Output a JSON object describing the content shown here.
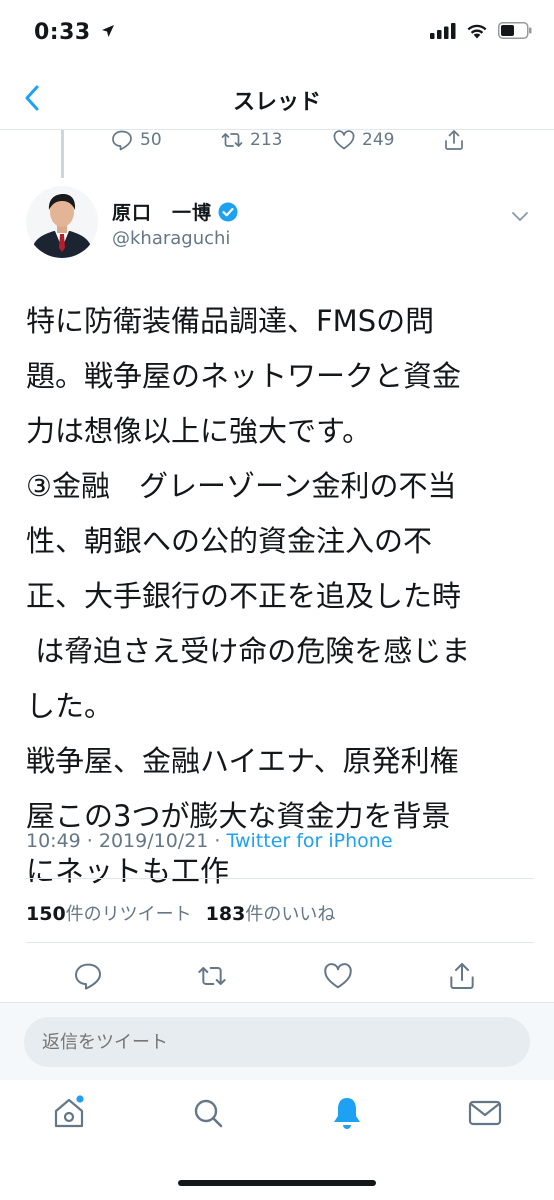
{
  "status_bar": {
    "time": "0:33"
  },
  "nav": {
    "title": "スレッド"
  },
  "previous_tweet": {
    "replies": "50",
    "retweets": "213",
    "likes": "249"
  },
  "tweet": {
    "name": "原口　一博",
    "handle": "@kharaguchi",
    "text": "特に防衛装備品調達、FMSの問\n題。戦争屋のネットワークと資金\n力は想像以上に強大です。\n③金融　グレーゾーン金利の不当\n性、朝銀への公的資金注入の不\n正、大手銀行の不正を追及した時\n は脅迫さえ受け命の危険を感じま\nした。\n戦争屋、金融ハイエナ、原発利権\n屋この3つが膨大な資金力を背景\nにネットも工作",
    "time": "10:49 · 2019/10/21 · ",
    "source": "Twitter for iPhone",
    "retweet_count": "150",
    "retweet_label": "件のリツイート",
    "like_count": "183",
    "like_label": "件のいいね"
  },
  "reply": {
    "placeholder": "返信をツイート"
  },
  "colors": {
    "accent": "#1da1f2",
    "secondary_text": "#657786",
    "verified": "#1da1f2"
  },
  "icons": [
    "back-chevron-icon",
    "reply-icon",
    "retweet-icon",
    "like-icon",
    "share-icon",
    "verified-badge-icon",
    "caret-down-icon",
    "home-icon",
    "search-icon",
    "notifications-icon",
    "messages-icon"
  ]
}
